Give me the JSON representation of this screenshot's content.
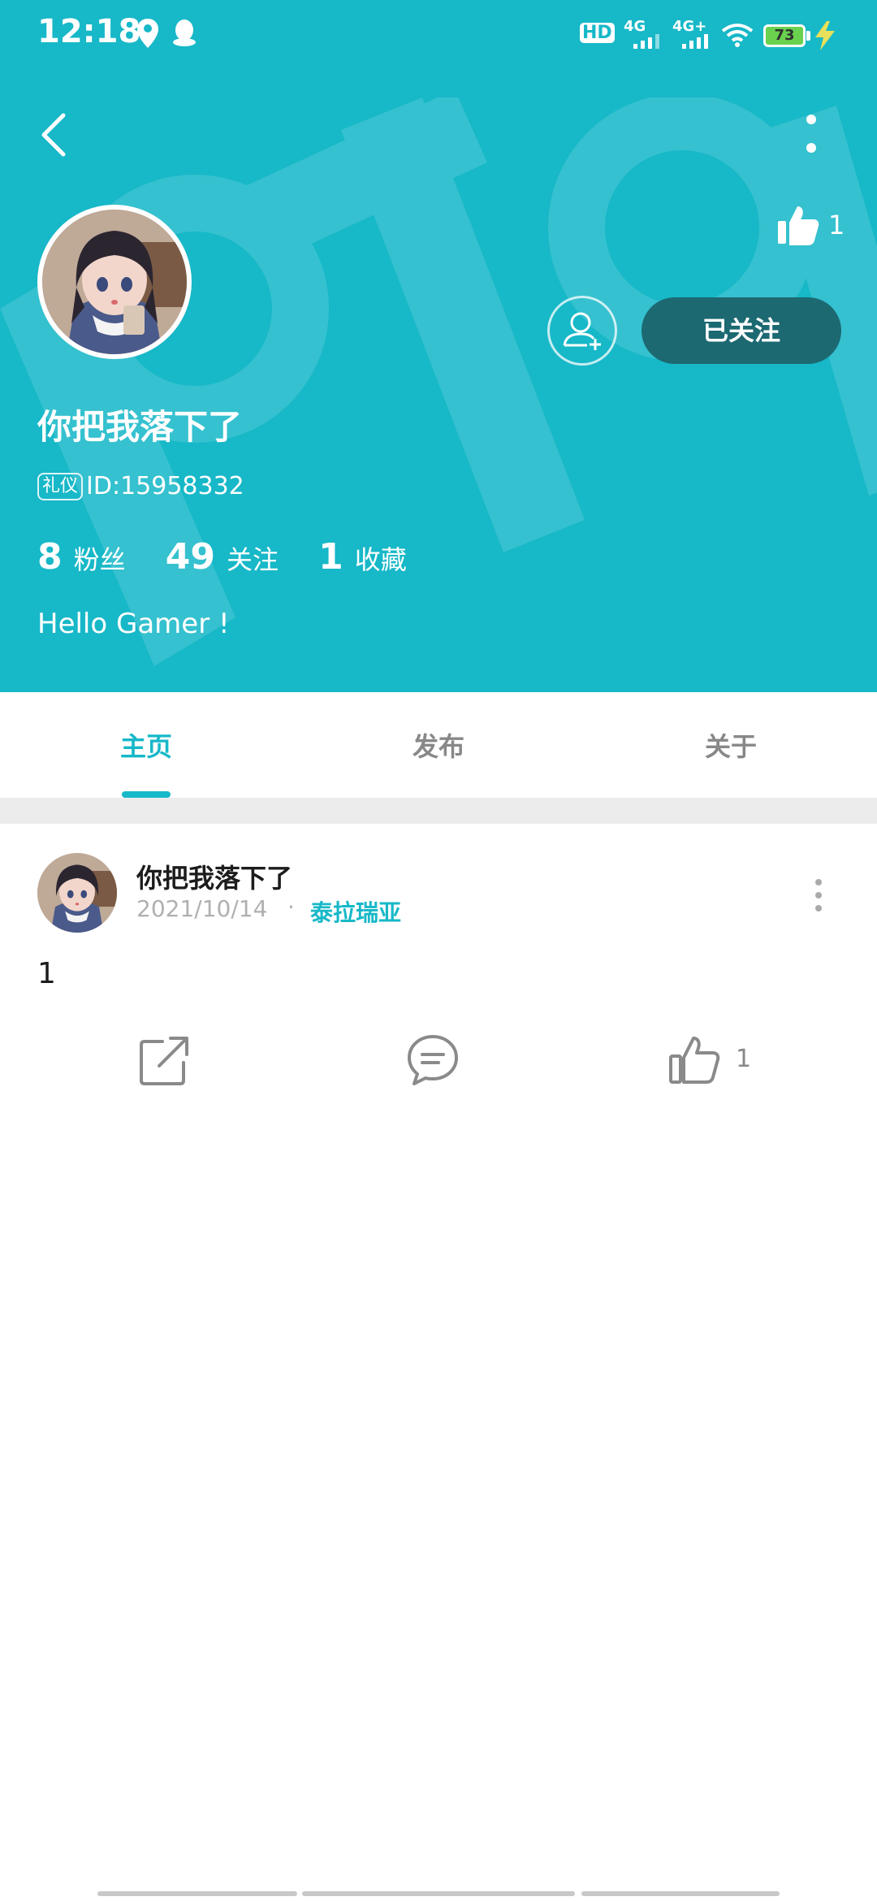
{
  "status_bar": {
    "time": "12:18",
    "battery": "73",
    "network_1": "4G",
    "network_2": "4G+",
    "hd_label": "HD"
  },
  "profile": {
    "username": "你把我落下了",
    "badge": "礼仪",
    "id": "ID:15958332",
    "likes": "1",
    "follow_button": "已关注",
    "stats": [
      {
        "value": "8",
        "label": "粉丝"
      },
      {
        "value": "49",
        "label": "关注"
      },
      {
        "value": "1",
        "label": "收藏"
      }
    ],
    "bio": "Hello Gamer !"
  },
  "tabs": [
    {
      "label": "主页",
      "active": true
    },
    {
      "label": "发布",
      "active": false
    },
    {
      "label": "关于",
      "active": false
    }
  ],
  "post": {
    "author": "你把我落下了",
    "date": "2021/10/14",
    "separator": "·",
    "topic": "泰拉瑞亚",
    "text": "1",
    "like_count": "1"
  },
  "colors": {
    "accent": "#17b8c8",
    "follow_button": "#1c6972"
  },
  "icons": [
    "back-icon",
    "more-vertical-icon",
    "thumb-up-icon",
    "add-friend-icon",
    "share-icon",
    "comment-icon",
    "location-icon",
    "qq-icon",
    "wifi-icon",
    "charging-icon"
  ]
}
